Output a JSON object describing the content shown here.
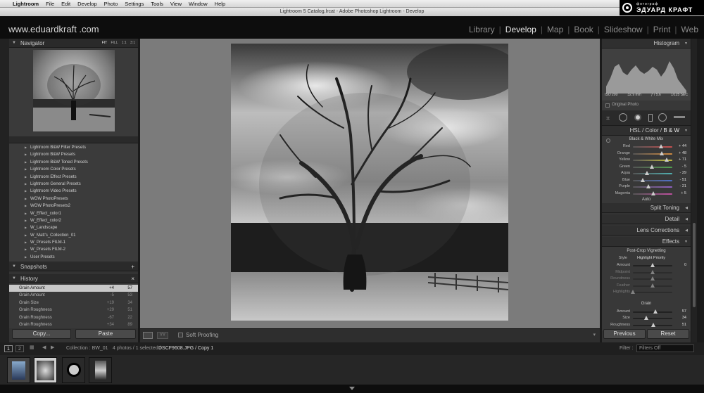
{
  "menubar": {
    "apple": "",
    "app": "Lightroom",
    "items": [
      "File",
      "Edit",
      "Develop",
      "Photo",
      "Settings",
      "Tools",
      "View",
      "Window",
      "Help"
    ]
  },
  "watermark": {
    "line1": "фотограф",
    "line2": "ЭДУАРД КРАФТ"
  },
  "window_title": "Lightroom 5 Catalog.lrcat - Adobe Photoshop Lightroom - Develop",
  "site": "www.eduardkraft .com",
  "modules": [
    "Library",
    "Develop",
    "Map",
    "Book",
    "Slideshow",
    "Print",
    "Web"
  ],
  "active_module": "Develop",
  "navigator": {
    "title": "Navigator",
    "zoom": [
      "FIT",
      "FILL",
      "1:1",
      "3:1"
    ]
  },
  "presets": [
    "Lightroom B&W Filter Presets",
    "Lightroom B&W Presets",
    "Lightroom B&W Toned Presets",
    "Lightroom Color Presets",
    "Lightroom Effect Presets",
    "Lightroom General Presets",
    "Lightroom Video Presets",
    "WOW PhotoPresets",
    "WOW PhotoPresets2",
    "W_Effect_color1",
    "W_Effect_color2",
    "W_Landscape",
    "W_Matt's_Collection_01",
    "W_Presets FILM-1",
    "W_Presets FILM-2",
    "User Presets"
  ],
  "snapshots": {
    "title": "Snapshots",
    "add": "+"
  },
  "history": {
    "title": "History",
    "close": "×",
    "rows": [
      {
        "label": "Grain Amount",
        "a": "+4",
        "b": "57"
      },
      {
        "label": "Grain Amount",
        "a": "-5",
        "b": "53"
      },
      {
        "label": "Grain Size",
        "a": "+19",
        "b": "34"
      },
      {
        "label": "Grain Roughness",
        "a": "+29",
        "b": "51"
      },
      {
        "label": "Grain Roughness",
        "a": "-67",
        "b": "22"
      },
      {
        "label": "Grain Roughness",
        "a": "+34",
        "b": "89"
      }
    ]
  },
  "left_buttons": {
    "copy": "Copy...",
    "paste": "Paste"
  },
  "toolbar": {
    "soft_proofing": "Soft Proofing"
  },
  "histogram": {
    "title": "Histogram",
    "iso": "ISO 200",
    "focal": "32.9 mm",
    "aperture": "ƒ / 5.6",
    "shutter": "1/125 SEC",
    "original": "Original Photo"
  },
  "hsl": {
    "tabs": [
      "HSL",
      "Color",
      "B & W"
    ],
    "active": "B & W",
    "mix_title": "Black & White Mix",
    "sliders": [
      {
        "label": "Red",
        "value": "+ 44",
        "pos": 0.72,
        "color": "#c85050"
      },
      {
        "label": "Orange",
        "value": "+ 48",
        "pos": 0.74,
        "color": "#d08a40"
      },
      {
        "label": "Yellow",
        "value": "+ 71",
        "pos": 0.85,
        "color": "#c8c040"
      },
      {
        "label": "Green",
        "value": "- 5",
        "pos": 0.48,
        "color": "#50a050"
      },
      {
        "label": "Aqua",
        "value": "- 29",
        "pos": 0.36,
        "color": "#50b0b0"
      },
      {
        "label": "Blue",
        "value": "- 51",
        "pos": 0.25,
        "color": "#5070c8"
      },
      {
        "label": "Purple",
        "value": "- 21",
        "pos": 0.4,
        "color": "#9060c0"
      },
      {
        "label": "Magenta",
        "value": "+ 5",
        "pos": 0.52,
        "color": "#c050a0"
      }
    ],
    "auto": "Auto"
  },
  "panels": {
    "split": "Split Toning",
    "detail": "Detail",
    "lens": "Lens Corrections",
    "effects": "Effects"
  },
  "effects": {
    "vignette_title": "Post-Crop Vignetting",
    "style_label": "Style",
    "style_value": "Highlight Priority",
    "vig_sliders": [
      {
        "label": "Amount",
        "value": "0",
        "pos": 0.5
      },
      {
        "label": "Midpoint",
        "value": "",
        "pos": 0.5
      },
      {
        "label": "Roundness",
        "value": "",
        "pos": 0.5
      },
      {
        "label": "Feather",
        "value": "",
        "pos": 0.5
      },
      {
        "label": "Highlights",
        "value": "",
        "pos": 0.0
      }
    ],
    "grain_title": "Grain",
    "grain_sliders": [
      {
        "label": "Amount",
        "value": "57",
        "pos": 0.57
      },
      {
        "label": "Size",
        "value": "34",
        "pos": 0.34
      },
      {
        "label": "Roughness",
        "value": "51",
        "pos": 0.51
      }
    ]
  },
  "right_buttons": {
    "previous": "Previous",
    "reset": "Reset"
  },
  "filmbar": {
    "pages": [
      "1",
      "2"
    ],
    "collection": "Collection : BW_01",
    "count": "4 photos / 1 selected /",
    "file": "DSCF9608.JPG / Copy 1",
    "filter_label": "Filter :",
    "filter_value": "Filters Off"
  }
}
